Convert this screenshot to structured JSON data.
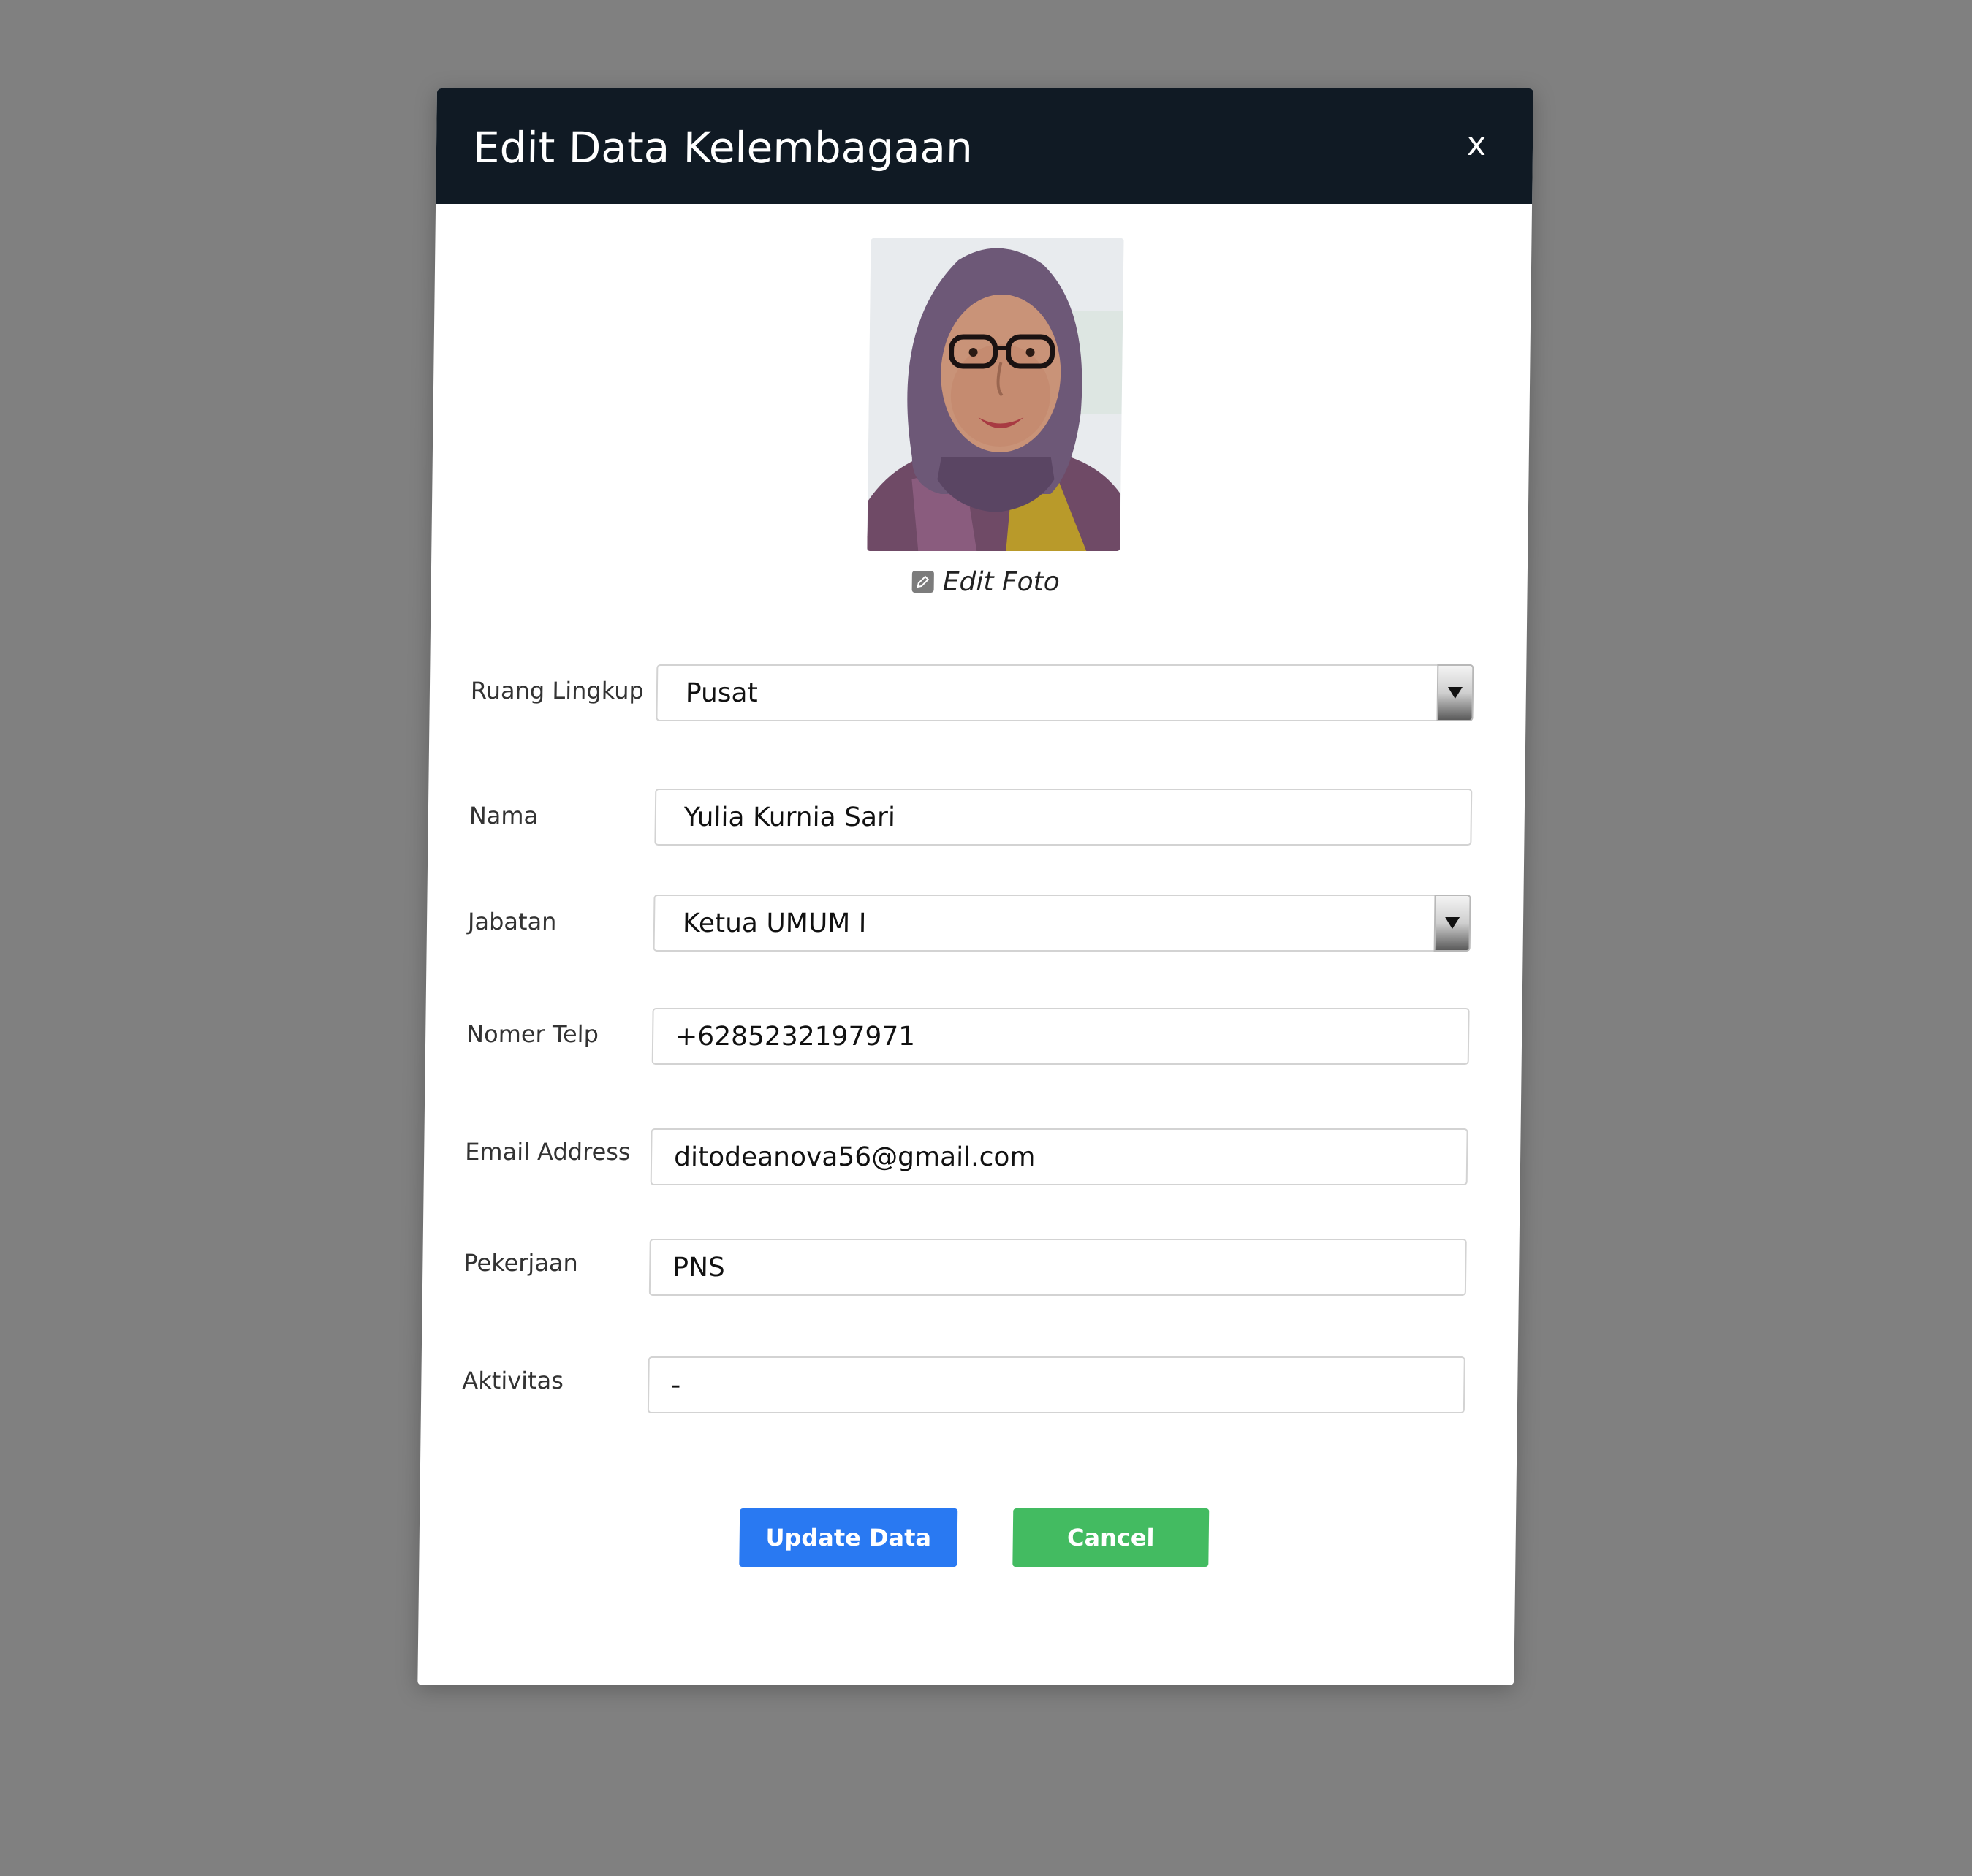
{
  "dialog": {
    "title": "Edit Data Kelembagaan",
    "close_label": "x",
    "edit_photo_label": "Edit Foto"
  },
  "form": {
    "ruang_lingkup": {
      "label": "Ruang Lingkup",
      "value": "Pusat"
    },
    "nama": {
      "label": "Nama",
      "value": "Yulia Kurnia Sari"
    },
    "jabatan": {
      "label": "Jabatan",
      "value": "Ketua UMUM I"
    },
    "nomer_telp": {
      "label": "Nomer Telp",
      "value": "+6285232197971"
    },
    "email": {
      "label": "Email Address",
      "value": "ditodeanova56@gmail.com"
    },
    "pekerjaan": {
      "label": "Pekerjaan",
      "value": "PNS"
    },
    "aktivitas": {
      "label": "Aktivitas",
      "value": "-"
    }
  },
  "buttons": {
    "update_label": "Update Data",
    "cancel_label": "Cancel"
  },
  "colors": {
    "header_bg": "#101a24",
    "update_button": "#2979f2",
    "cancel_button": "#43bb61",
    "backdrop": "#808080"
  }
}
